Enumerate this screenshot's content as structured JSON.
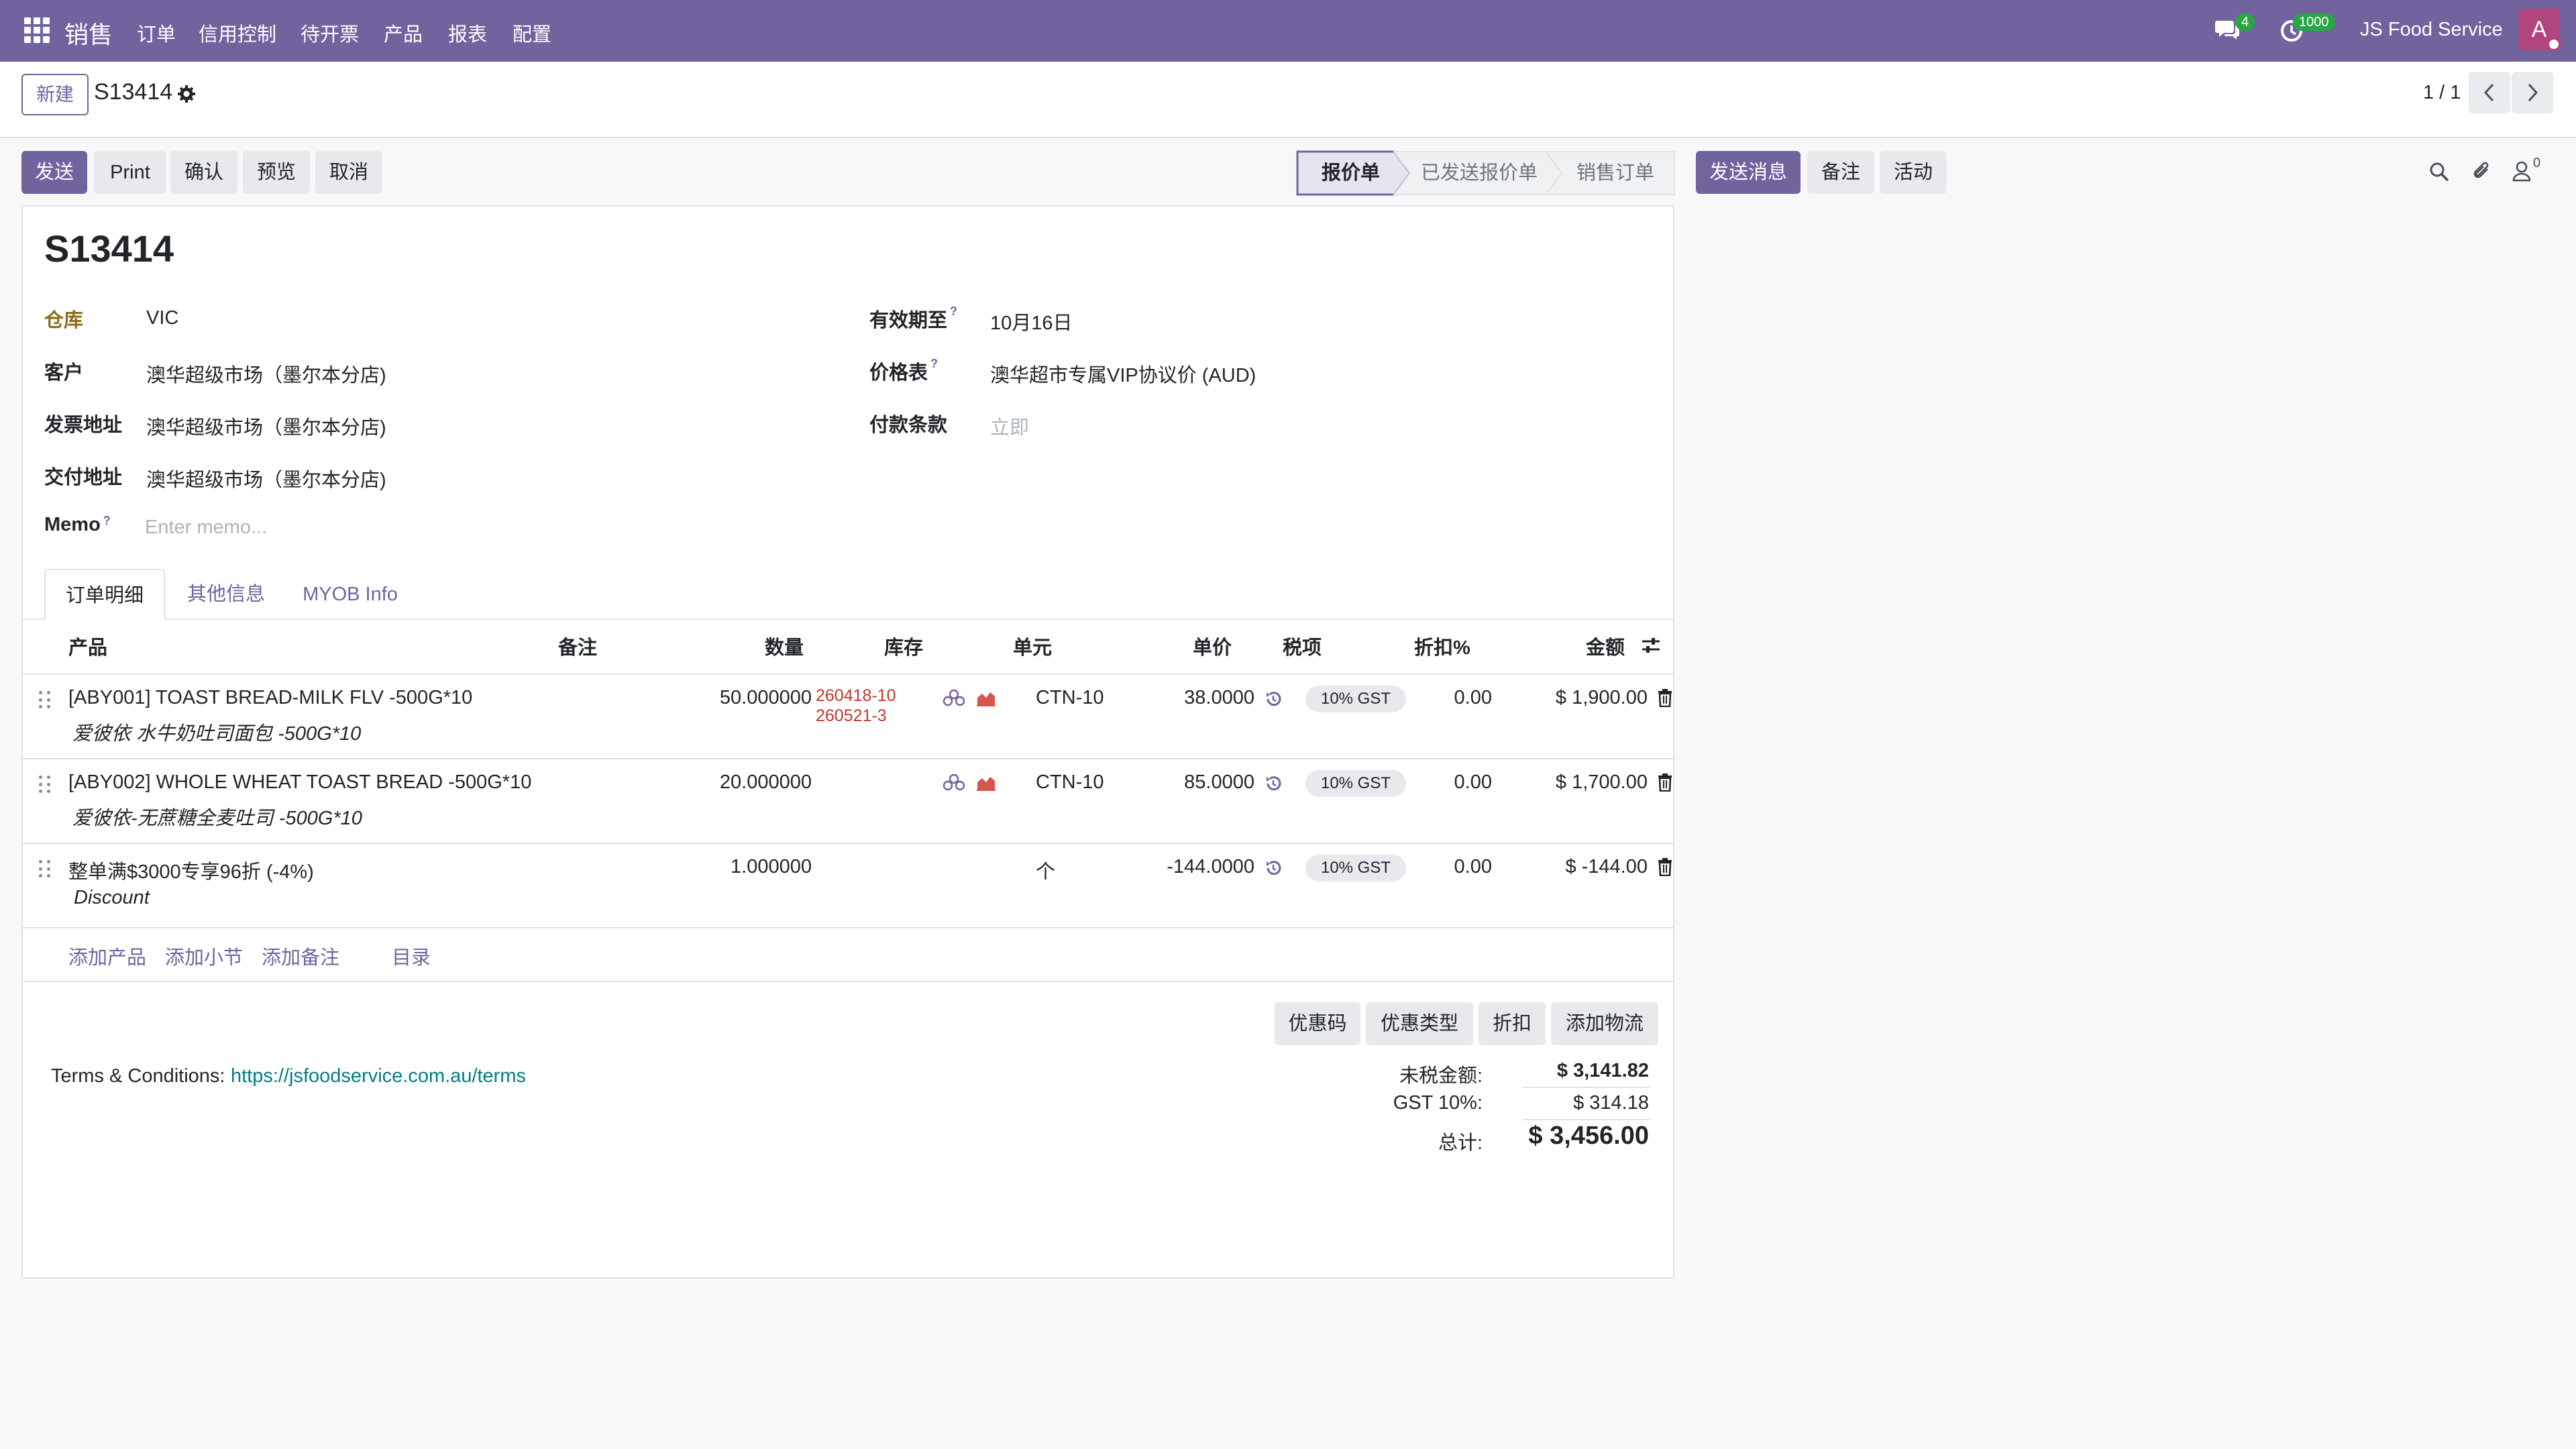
{
  "topnav": {
    "app_name": "销售",
    "menu": [
      "订单",
      "信用控制",
      "待开票",
      "产品",
      "报表",
      "配置"
    ],
    "messages_count": "4",
    "activities_count": "1000",
    "company": "JS Food Service",
    "avatar_letter": "A"
  },
  "control_panel": {
    "new_label": "新建",
    "record_name": "S13414",
    "pager": "1 / 1"
  },
  "actions": {
    "send": "发送",
    "print": "Print",
    "confirm": "确认",
    "preview": "预览",
    "cancel": "取消"
  },
  "status_steps": [
    "报价单",
    "已发送报价单",
    "销售订单"
  ],
  "chatter": {
    "send_message": "发送消息",
    "log_note": "备注",
    "activity": "活动",
    "followers": "0"
  },
  "form": {
    "title": "S13414",
    "warehouse_label": "仓库",
    "warehouse": "VIC",
    "customer_label": "客户",
    "customer": "澳华超级市场（墨尔本分店)",
    "invoice_address_label": "发票地址",
    "invoice_address": "澳华超级市场（墨尔本分店)",
    "delivery_address_label": "交付地址",
    "delivery_address": "澳华超级市场（墨尔本分店)",
    "memo_label": "Memo",
    "memo_placeholder": "Enter memo...",
    "validity_label": "有效期至",
    "validity": "10月16日",
    "pricelist_label": "价格表",
    "pricelist": "澳华超市专属VIP协议价 (AUD)",
    "payment_terms_label": "付款条款",
    "payment_terms_placeholder": "立即",
    "help_mark": "?"
  },
  "tabs": [
    "订单明细",
    "其他信息",
    "MYOB Info"
  ],
  "table": {
    "headers": {
      "product": "产品",
      "note": "备注",
      "qty": "数量",
      "stock": "库存",
      "uom": "单元",
      "price": "单价",
      "tax": "税项",
      "discount": "折扣%",
      "amount": "金额"
    },
    "rows": [
      {
        "product": "[ABY001] TOAST BREAD-MILK FLV -500G*10",
        "description": "爱彼依 水牛奶吐司面包 -500G*10",
        "qty": "50.000000",
        "lots": [
          "260418-10",
          "260521-3"
        ],
        "uom": "CTN-10",
        "price": "38.0000",
        "tax": "10% GST",
        "discount": "0.00",
        "amount": "$ 1,900.00"
      },
      {
        "product": "[ABY002] WHOLE WHEAT TOAST BREAD -500G*10",
        "description": "爱彼依-无蔗糖全麦吐司 -500G*10",
        "qty": "20.000000",
        "lots": [],
        "uom": "CTN-10",
        "price": "85.0000",
        "tax": "10% GST",
        "discount": "0.00",
        "amount": "$ 1,700.00"
      },
      {
        "product": "整单满$3000专享96折 (-4%)",
        "description": "Discount",
        "qty": "1.000000",
        "lots": [],
        "uom": "个",
        "price": "-144.0000",
        "tax": "10% GST",
        "discount": "0.00",
        "amount": "$ -144.00"
      }
    ],
    "add_links": [
      "添加产品",
      "添加小节",
      "添加备注",
      "目录"
    ]
  },
  "promo_buttons": [
    "优惠码",
    "优惠类型",
    "折扣",
    "添加物流"
  ],
  "terms": {
    "label": "Terms & Conditions:",
    "url": "https://jsfoodservice.com.au/terms"
  },
  "totals": {
    "untaxed_label": "未税金额:",
    "untaxed": "$ 3,141.82",
    "gst_label": "GST 10%:",
    "gst": "$ 314.18",
    "total_label": "总计:",
    "total": "$ 3,456.00"
  },
  "colors": {
    "brand": "#71639e",
    "lot_red": "#c0392b",
    "link_teal": "#017e84",
    "badge_green": "#28a745"
  }
}
